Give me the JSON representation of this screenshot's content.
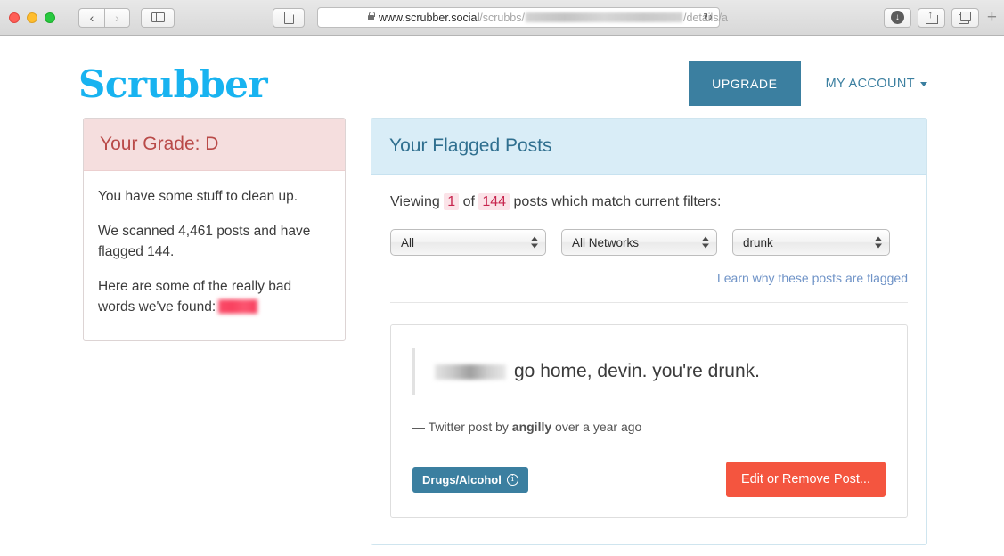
{
  "browser": {
    "url": {
      "domain": "www.scrubber.social",
      "path_before": "/scrubbs/",
      "path_after": "/details/a"
    },
    "icons": {
      "back": "‹",
      "forward": "›",
      "reload": "↻",
      "download": "↓",
      "new_tab": "+"
    }
  },
  "header": {
    "logo": "Scrubber",
    "upgrade_label": "UPGRADE",
    "my_account_label": "MY ACCOUNT"
  },
  "grade_panel": {
    "title": "Your Grade: D",
    "line1": "You have some stuff to clean up.",
    "line2": "We scanned 4,461 posts and have flagged 144.",
    "line3": "Here are some of the really bad words we've found:"
  },
  "flagged_panel": {
    "title": "Your Flagged Posts",
    "viewing_prefix": "Viewing",
    "viewing_current": "1",
    "viewing_of": "of",
    "viewing_total": "144",
    "viewing_suffix": "posts which match current filters:",
    "filters": [
      {
        "name": "type-filter",
        "value": "All"
      },
      {
        "name": "network-filter",
        "value": "All Networks"
      },
      {
        "name": "keyword-filter",
        "value": "drunk"
      }
    ],
    "learn_link": "Learn why these posts are flagged",
    "post": {
      "text": "go home, devin. you're drunk.",
      "meta_prefix": "— Twitter post by",
      "meta_author": "angilly",
      "meta_suffix": "over a year ago",
      "badge_label": "Drugs/Alcohol",
      "badge_info_glyph": "i",
      "action_label": "Edit or Remove Post..."
    }
  },
  "colors": {
    "brand_blue": "#18b3f0",
    "steel_blue": "#3b7fa0",
    "danger_red": "#f4553f",
    "grade_red": "#b94a48",
    "panel_blue": "#d9edf7",
    "panel_pink": "#f5dede"
  }
}
